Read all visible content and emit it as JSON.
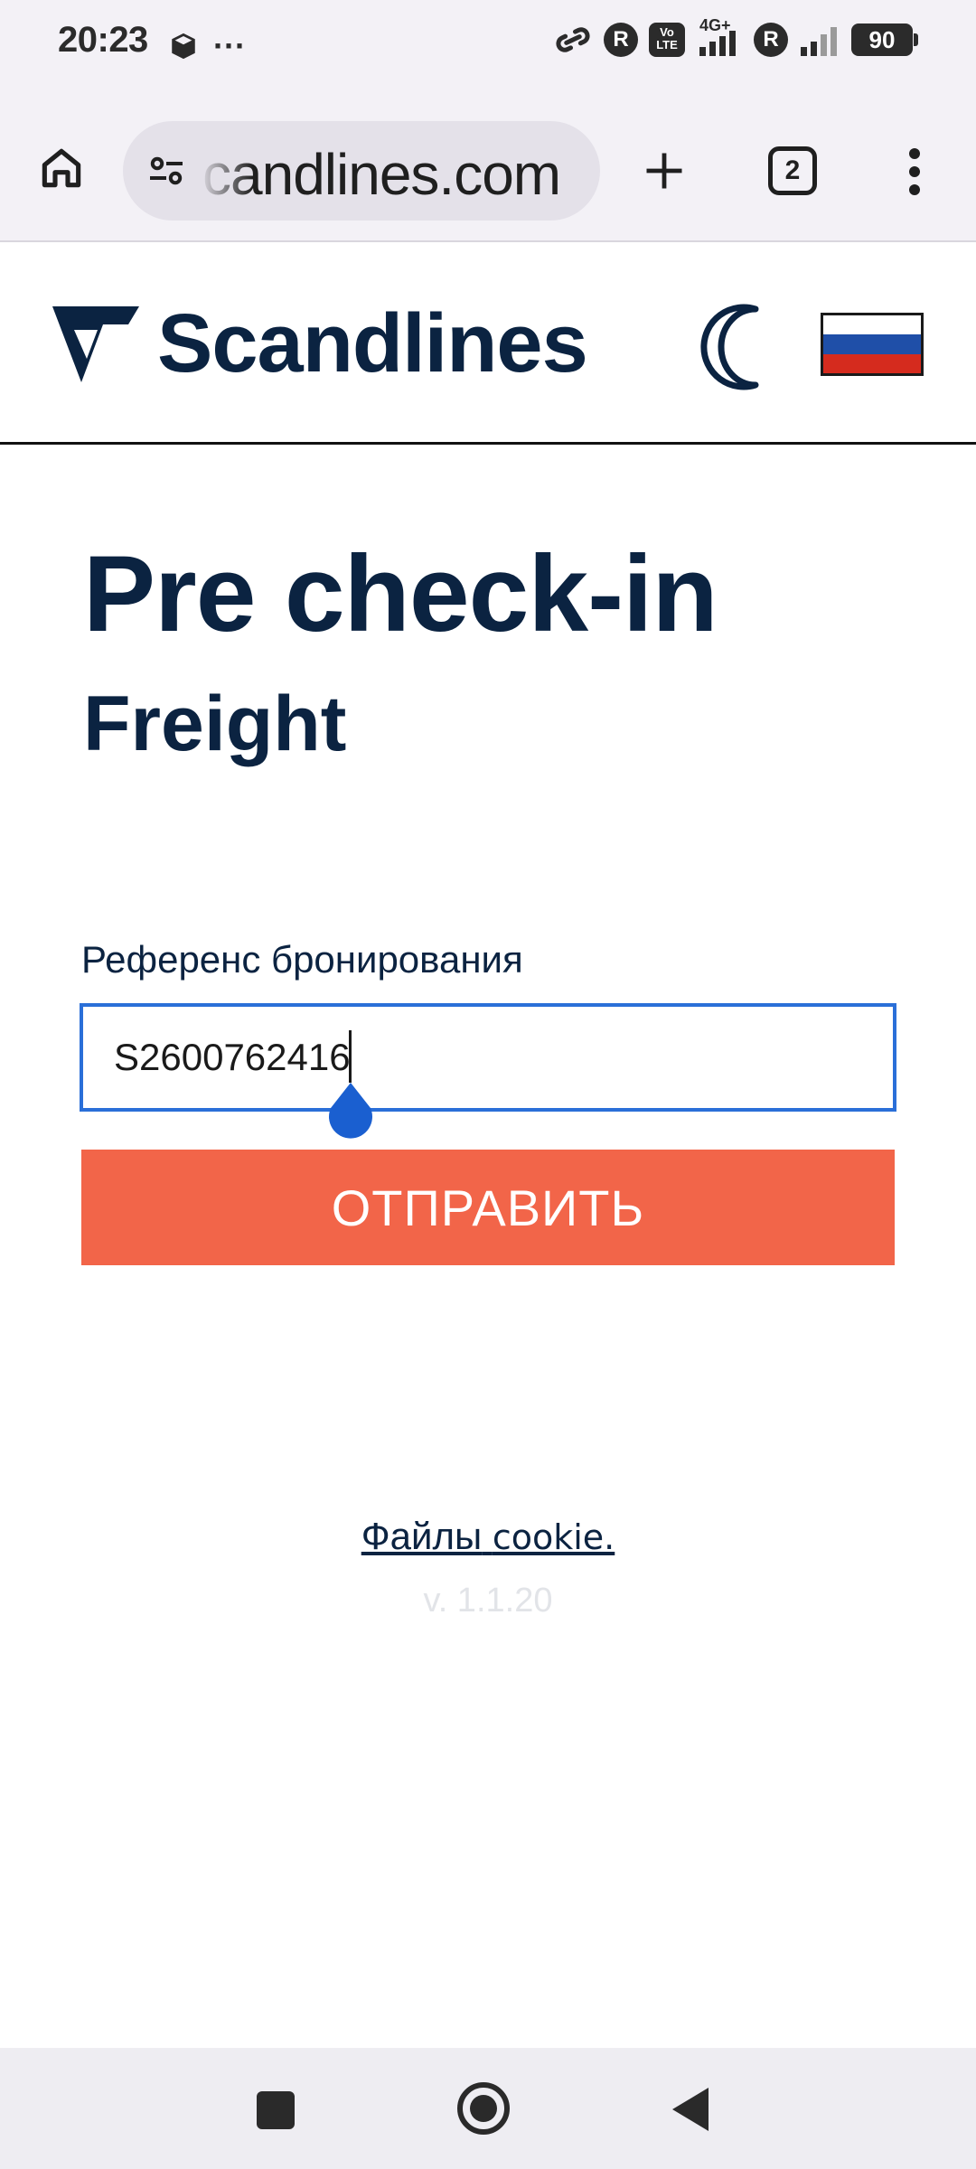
{
  "status_bar": {
    "time": "20:23",
    "dots": "···",
    "network": "4G+",
    "volte": "Vo LTE",
    "roaming_badge_1": "R",
    "roaming_badge_2": "R",
    "battery": "90"
  },
  "browser": {
    "url": "candlines.com",
    "tab_count": "2"
  },
  "header": {
    "logo_text": "Scandlines",
    "flag_colors": [
      "#ffffff",
      "#1f4fa8",
      "#d52b1e"
    ]
  },
  "main": {
    "title": "Pre check-in",
    "subtitle": "Freight",
    "field_label": "Референс бронирования",
    "field_value": "S2600762416",
    "submit_label": "ОТПРАВИТЬ",
    "accent_color": "#f26549"
  },
  "footer": {
    "cookie_prefix": "Файлы",
    "cookie_link": "cookie.",
    "version": "v. 1.1.20"
  }
}
